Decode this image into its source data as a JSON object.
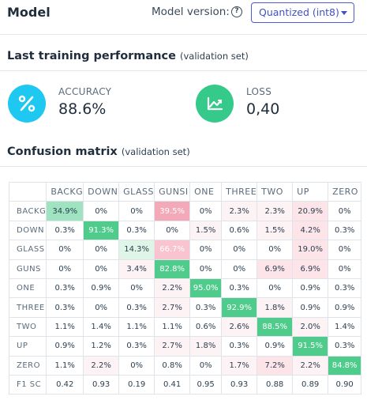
{
  "header": {
    "title": "Model",
    "model_version_label": "Model version:",
    "model_version_value": "Quantized (int8)"
  },
  "performance": {
    "title": "Last training performance",
    "subtitle": "(validation set)",
    "accuracy": {
      "label": "ACCURACY",
      "value": "88.6%",
      "color": "#1ec8f0",
      "icon": "percent-icon"
    },
    "loss": {
      "label": "LOSS",
      "value": "0,40",
      "color": "#35c98a",
      "icon": "trend-chart-icon"
    }
  },
  "confusion": {
    "title": "Confusion matrix",
    "subtitle": "(validation set)",
    "columns": [
      "BACKGROUND",
      "DOWN",
      "GLASS",
      "GUNSHOT",
      "ONE",
      "THREE",
      "TWO",
      "UP",
      "ZERO"
    ],
    "column_labels_shown": [
      "BACKG",
      "DOWN",
      "GLASS",
      "GUNSI",
      "ONE",
      "THREE",
      "TWO",
      "UP",
      "ZERO"
    ],
    "rows": [
      {
        "label": "BACKG",
        "cells": [
          "34.9%",
          "0%",
          "0%",
          "39.5%",
          "0%",
          "2.3%",
          "2.3%",
          "20.9%",
          "0%"
        ]
      },
      {
        "label": "DOWN",
        "cells": [
          "0.3%",
          "91.3%",
          "0.3%",
          "0%",
          "1.5%",
          "0.6%",
          "1.5%",
          "4.2%",
          "0.3%"
        ]
      },
      {
        "label": "GLASS",
        "cells": [
          "0%",
          "0%",
          "14.3%",
          "66.7%",
          "0%",
          "0%",
          "0%",
          "19.0%",
          "0%"
        ]
      },
      {
        "label": "GUNS",
        "cells": [
          "0%",
          "0%",
          "3.4%",
          "82.8%",
          "0%",
          "0%",
          "6.9%",
          "6.9%",
          "0%"
        ]
      },
      {
        "label": "ONE",
        "cells": [
          "0.3%",
          "0.9%",
          "0%",
          "2.2%",
          "95.0%",
          "0.3%",
          "0%",
          "0.9%",
          "0.3%"
        ]
      },
      {
        "label": "THREE",
        "cells": [
          "0.3%",
          "0%",
          "0.3%",
          "2.7%",
          "0.3%",
          "92.9%",
          "1.8%",
          "0.9%",
          "0.9%"
        ]
      },
      {
        "label": "TWO",
        "cells": [
          "1.1%",
          "1.4%",
          "1.1%",
          "1.1%",
          "0.6%",
          "2.6%",
          "88.5%",
          "2.0%",
          "1.4%"
        ]
      },
      {
        "label": "UP",
        "cells": [
          "0.9%",
          "1.2%",
          "0.3%",
          "2.7%",
          "1.8%",
          "0.3%",
          "0.9%",
          "91.5%",
          "0.3%"
        ]
      },
      {
        "label": "ZERO",
        "cells": [
          "1.1%",
          "2.2%",
          "0%",
          "0.8%",
          "0%",
          "1.7%",
          "7.2%",
          "2.2%",
          "84.8%"
        ]
      }
    ],
    "f1": {
      "label": "F1 SC",
      "cells": [
        "0.42",
        "0.93",
        "0.19",
        "0.41",
        "0.95",
        "0.93",
        "0.88",
        "0.89",
        "0.90"
      ]
    },
    "colors": {
      "correct": "#4fcc8c",
      "error": "#f4a9b8"
    }
  }
}
